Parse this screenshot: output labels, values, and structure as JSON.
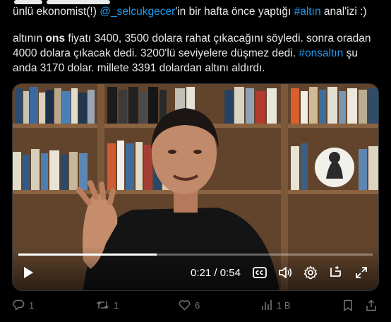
{
  "tweet": {
    "line1_pre": "ünlü ekonomist(!) ",
    "line1_mention": "@_selcukgecer",
    "line1_mid": "'in bir hafta önce yaptığı ",
    "line1_hashtag": "#altın",
    "line1_post": " anal'izi :)",
    "p2_a": "altının ",
    "p2_bold": "ons",
    "p2_b": " fiyatı 3400, 3500 dolara rahat çıkacağını söyledi. sonra oradan 4000 dolara çıkacak dedi. 3200'lü seviyelere düşmez dedi. ",
    "p2_hashtag": "#onsaltın",
    "p2_c": " şu anda 3170 dolar. millete 3391 dolardan altını aldırdı."
  },
  "video": {
    "time_current": "0:21",
    "time_separator": " / ",
    "time_total": "0:54",
    "progress_fraction": 0.39,
    "controls": {
      "play": "play-icon",
      "captions": "captions-icon",
      "volume": "volume-icon",
      "settings": "gear-icon",
      "pip": "picture-in-picture-icon",
      "fullscreen": "fullscreen-icon"
    }
  },
  "actions": {
    "reply_count": "1",
    "retweet_count": "1",
    "like_count": "6",
    "views_count": "1 B"
  },
  "colors": {
    "background": "#000000",
    "text": "#e7e9ea",
    "link": "#1d9bf0",
    "muted": "#71767b"
  }
}
